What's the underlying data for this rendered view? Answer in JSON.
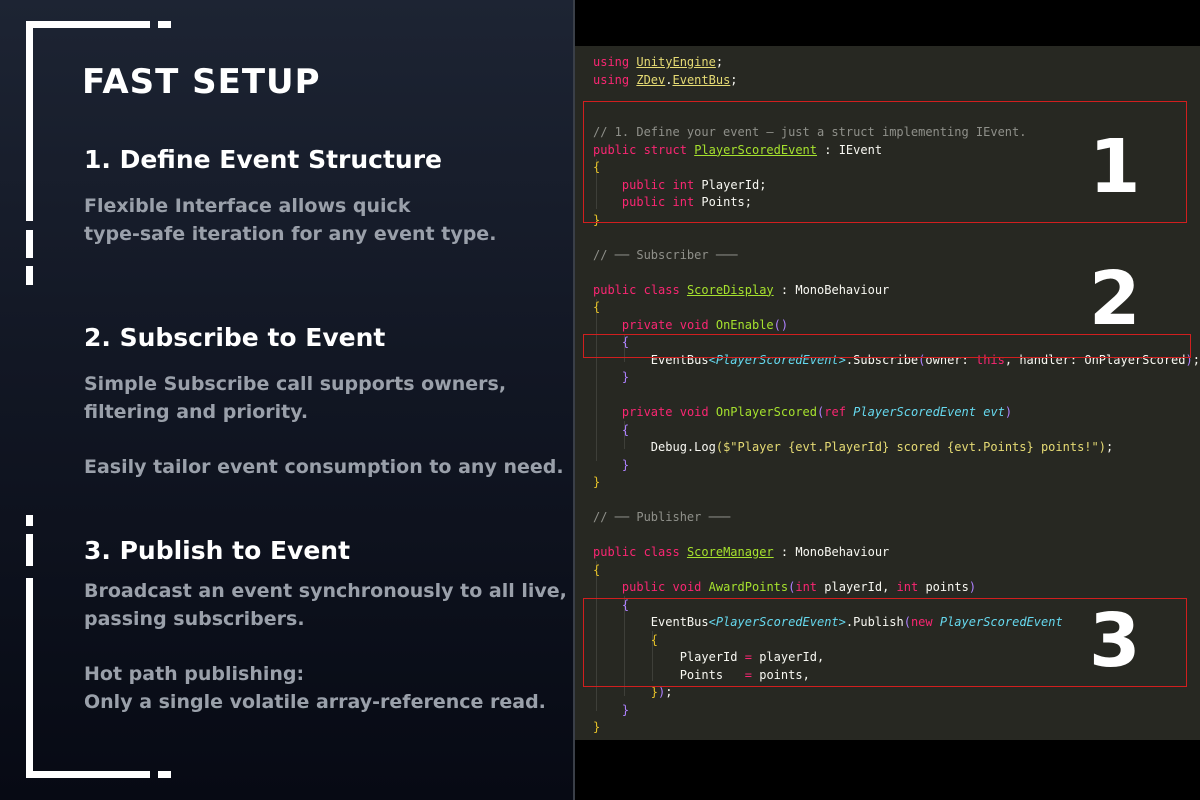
{
  "heading": "FAST SETUP",
  "sections": [
    {
      "title": "1. Define Event Structure",
      "lines": [
        "Flexible Interface allows quick",
        "type-safe iteration for any event type."
      ]
    },
    {
      "title": "2. Subscribe to Event",
      "lines": [
        "Simple Subscribe call supports owners,",
        "filtering and priority.",
        "",
        "Easily tailor event consumption to any need."
      ]
    },
    {
      "title": "3. Publish to Event",
      "lines": [
        "Broadcast an event synchronously to all live,",
        "passing subscribers.",
        "",
        "Hot path publishing:",
        "Only a single volatile array-reference read."
      ]
    }
  ],
  "markers": [
    "1",
    "2",
    "3"
  ],
  "code": {
    "kw_using": "using",
    "ns_unity": "UnityEngine",
    "ns_zdev": "ZDev",
    "ns_eventbus": "EventBus",
    "comment_define": "// 1. Define your event — just a struct implementing IEvent.",
    "kw_public": "public",
    "kw_struct": "struct",
    "event_type": "PlayerScoredEvent",
    "iface": "IEvent",
    "kw_int": "int",
    "field_playerid": "PlayerId",
    "field_points": "Points",
    "comment_subscriber": "// ── Subscriber ───",
    "kw_class": "class",
    "class_display": "ScoreDisplay",
    "base_mono": "MonoBehaviour",
    "kw_private": "private",
    "kw_void": "void",
    "fn_onenable": "OnEnable",
    "eventbus": "EventBus",
    "fn_subscribe": "Subscribe",
    "param_owner": "owner",
    "kw_this": "this",
    "param_handler": "handler",
    "handler_name": "OnPlayerScored",
    "kw_ref": "ref",
    "param_evt": "evt",
    "debug_call": "Debug.Log",
    "str_log": "$\"Player {evt.PlayerId} scored {evt.Points} points!\"",
    "comment_publisher": "// ── Publisher ───",
    "class_manager": "ScoreManager",
    "fn_award": "AwardPoints",
    "param_playerid": "playerId",
    "param_points": "points",
    "fn_publish": "Publish",
    "kw_new": "new",
    "assign_playerid": "PlayerId",
    "assign_points": "Points"
  },
  "colors": {
    "left_panel_top": "#1d2433",
    "left_panel_bottom": "#070a14",
    "editor_bg": "#272822",
    "highlight_box": "#d11f1f",
    "keyword": "#f92672",
    "type": "#66d9ef",
    "class_name": "#a6e22e",
    "comment": "#8f908a"
  }
}
